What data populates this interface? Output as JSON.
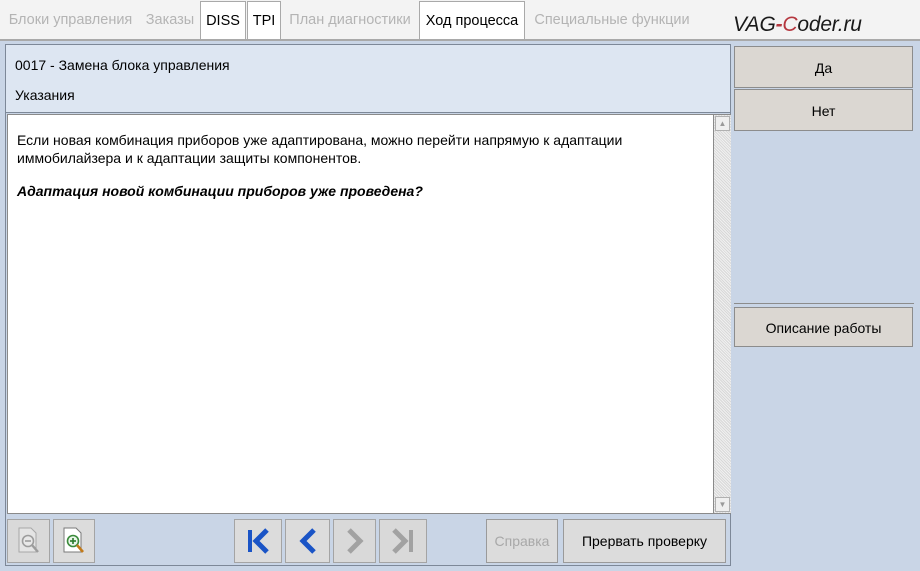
{
  "tabs": [
    {
      "label": "Блоки управления",
      "state": "disabled"
    },
    {
      "label": "Заказы",
      "state": "disabled"
    },
    {
      "label": "DISS",
      "state": "active"
    },
    {
      "label": "TPI",
      "state": "active"
    },
    {
      "label": "План диагностики",
      "state": "disabled"
    },
    {
      "label": "Ход процесса",
      "state": "active"
    },
    {
      "label": "Специальные функции",
      "state": "disabled"
    }
  ],
  "watermark": {
    "prefix": "VAG",
    "dash": "-",
    "c": "C",
    "suffix": "oder.ru"
  },
  "header": {
    "title": "0017 - Замена блока управления",
    "subtitle": "Указания"
  },
  "content": {
    "paragraph": "Если новая комбинация приборов уже адаптирована, можно перейти напрямую к адаптации иммобилайзера и к адаптации защиты компонентов.",
    "question": "Адаптация новой комбинации приборов уже проведена?"
  },
  "side_buttons": {
    "yes": "Да",
    "no": "Нет",
    "work_description": "Описание работы"
  },
  "toolbar": {
    "help": "Справка",
    "abort": "Прервать проверку"
  },
  "icons": {
    "zoom_out": "zoom-out-icon",
    "zoom_in": "zoom-in-icon",
    "first": "skip-first-icon",
    "prev": "chevron-left-icon",
    "next": "chevron-right-icon",
    "last": "skip-last-icon"
  },
  "colors": {
    "panel_bg": "#c9d5e6",
    "header_bg": "#dde6f2",
    "nav_blue": "#1a54c6",
    "button_bg": "#dcdcdc",
    "disabled_text": "#b4b4b4",
    "logo_accent": "#b5373f"
  }
}
